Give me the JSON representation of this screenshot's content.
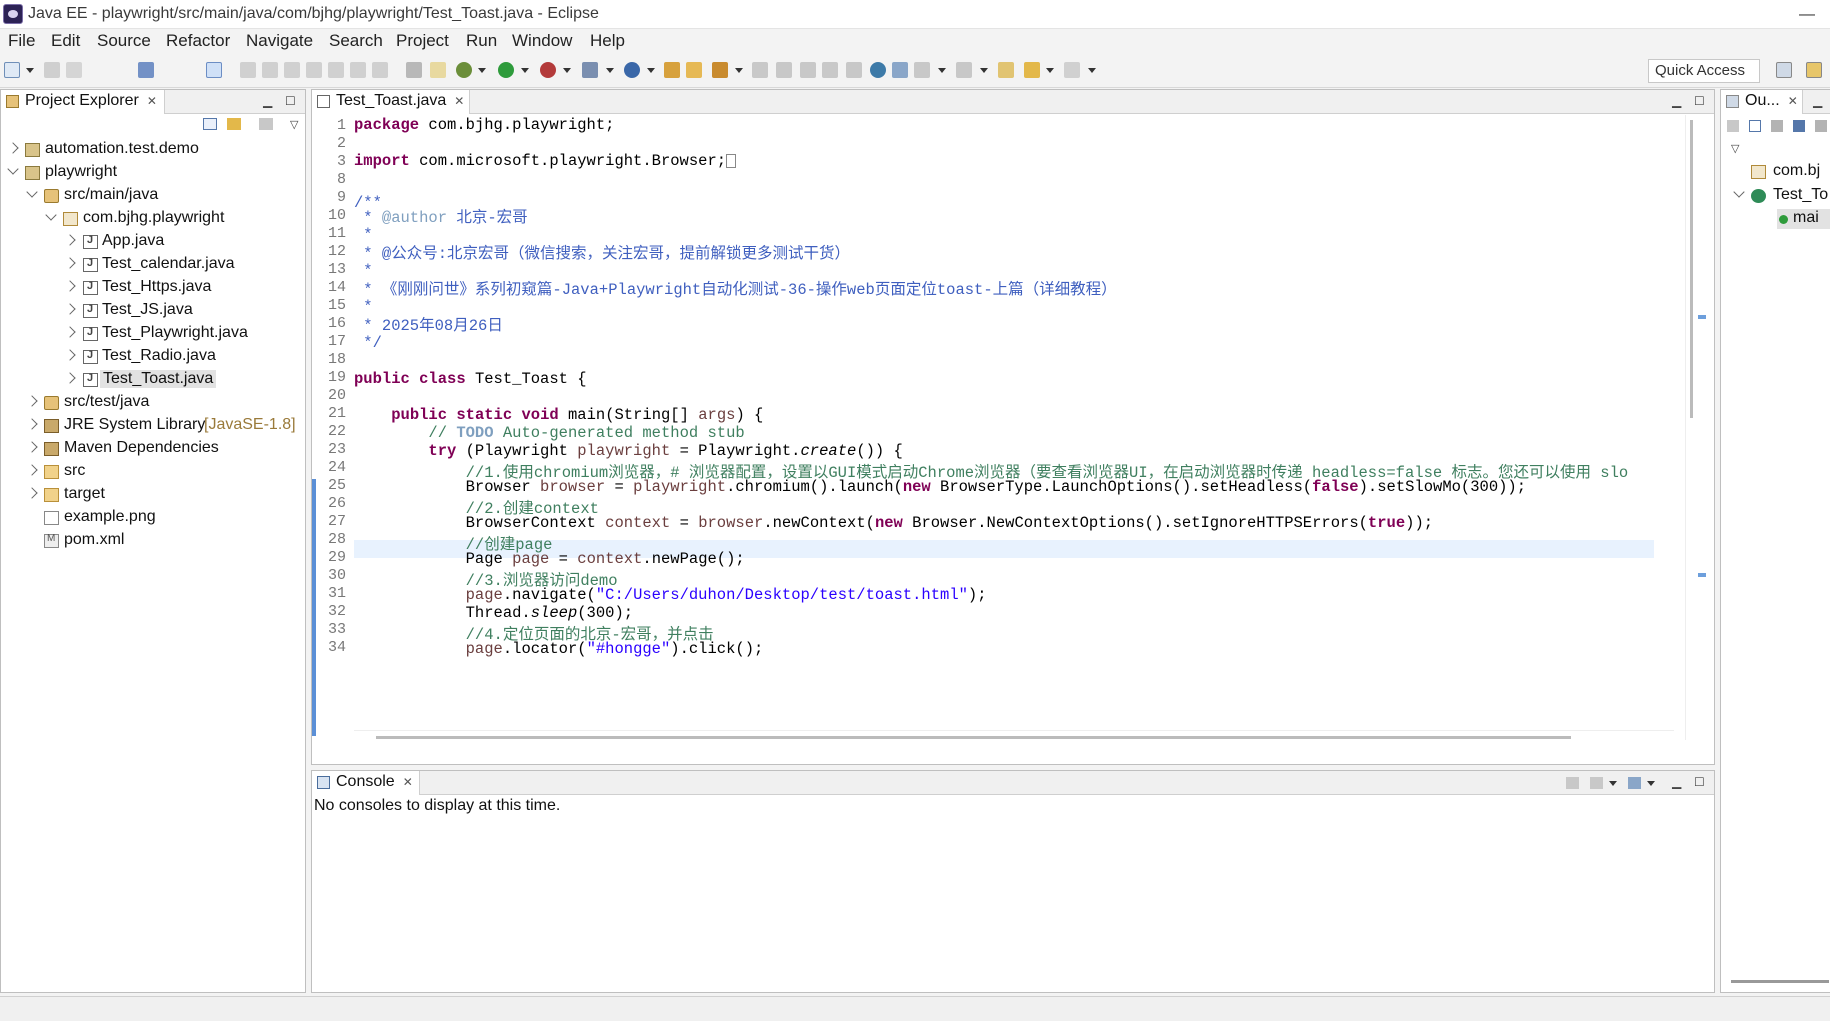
{
  "window": {
    "title": "Java EE - playwright/src/main/java/com/bjhg/playwright/Test_Toast.java - Eclipse"
  },
  "menu": [
    "File",
    "Edit",
    "Source",
    "Refactor",
    "Navigate",
    "Search",
    "Project",
    "Run",
    "Window",
    "Help"
  ],
  "toolbar": {
    "quick_access": "Quick Access"
  },
  "explorer": {
    "title": "Project Explorer",
    "items": [
      {
        "label": "automation.test.demo"
      },
      {
        "label": "playwright"
      },
      {
        "label": "src/main/java"
      },
      {
        "label": "com.bjhg.playwright"
      },
      {
        "label": "App.java"
      },
      {
        "label": "Test_calendar.java"
      },
      {
        "label": "Test_Https.java"
      },
      {
        "label": "Test_JS.java"
      },
      {
        "label": "Test_Playwright.java"
      },
      {
        "label": "Test_Radio.java"
      },
      {
        "label": "Test_Toast.java"
      },
      {
        "label": "src/test/java"
      },
      {
        "label": "JRE System Library",
        "decoration": "[JavaSE-1.8]"
      },
      {
        "label": "Maven Dependencies"
      },
      {
        "label": "src"
      },
      {
        "label": "target"
      },
      {
        "label": "example.png"
      },
      {
        "label": "pom.xml"
      }
    ]
  },
  "editor": {
    "tab": "Test_Toast.java",
    "line_numbers": [
      "1",
      "2",
      "3",
      "8",
      "9",
      "10",
      "11",
      "12",
      "13",
      "14",
      "15",
      "16",
      "17",
      "18",
      "19",
      "20",
      "21",
      "22",
      "23",
      "24",
      "25",
      "26",
      "27",
      "28",
      "29",
      "30",
      "31",
      "32",
      "33",
      "34"
    ]
  },
  "outline": {
    "title": "Ou...",
    "items": [
      "com.bj",
      "Test_To",
      "mai"
    ]
  },
  "console": {
    "title": "Console",
    "message": "No consoles to display at this time."
  },
  "colors": {
    "keyword": "#7f0055",
    "comment": "#3f7f5f",
    "javadoc": "#3f5fbf",
    "string": "#2a00ff",
    "variable": "#6a3e3e"
  }
}
